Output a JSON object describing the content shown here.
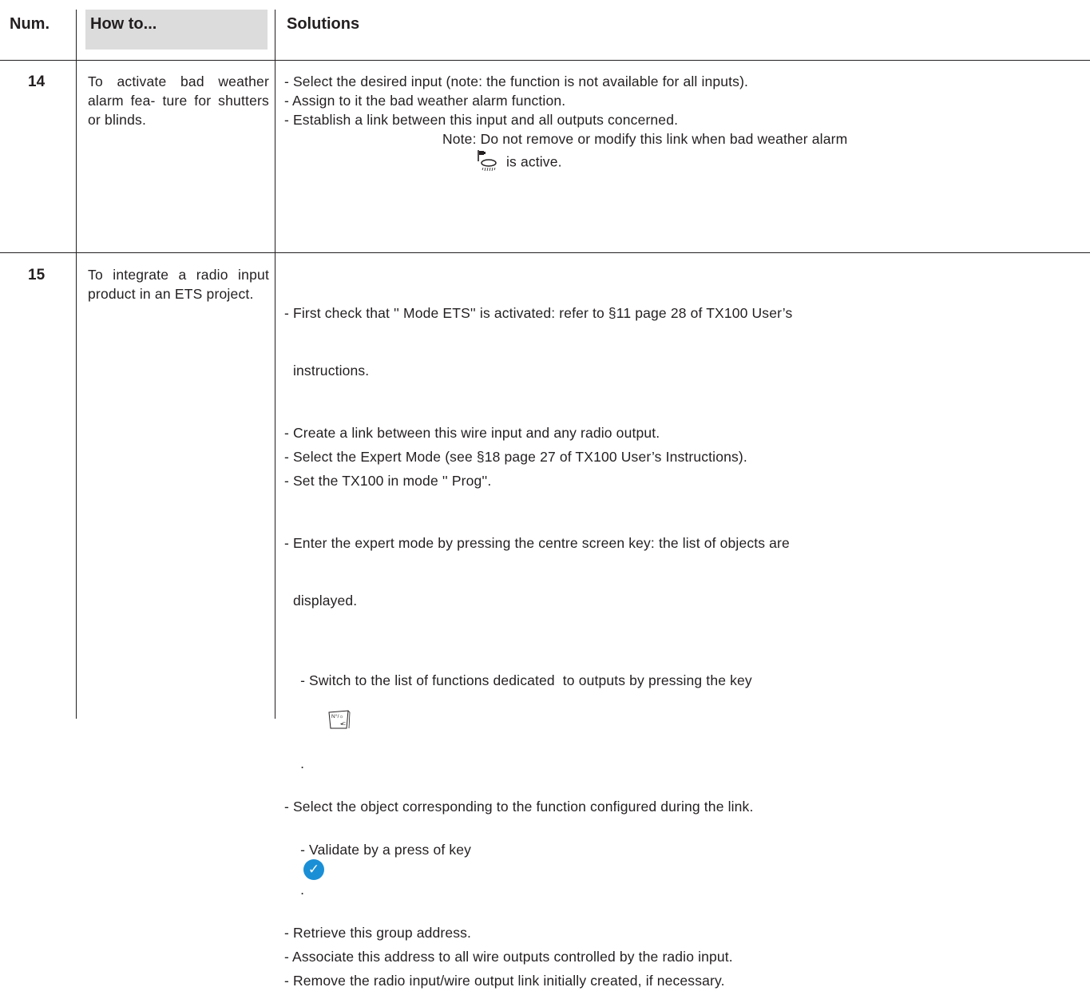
{
  "header": {
    "num": "Num.",
    "howto": "How to...",
    "solutions": "Solutions"
  },
  "rows": [
    {
      "num": "14",
      "howto": "To activate bad weather alarm fea- ture for shutters or blinds.",
      "items": [
        "- Select the desired input (note: the function is not available for all inputs).",
        "- Assign to it the bad weather alarm function.",
        "- Establish a link between this input and all outputs concerned."
      ],
      "note_line1": "Note: Do not remove or modify this link when bad weather alarm",
      "note_line2": "is active.",
      "note_icon": "bad-weather-alarm-icon"
    },
    {
      "num": "15",
      "howto": "To integrate a radio input product in an ETS project.",
      "items": [
        {
          "a": "- First check that '' Mode ETS'' is activated: refer to §11 page 28 of TX100 User’s",
          "b": "instructions."
        },
        "- Create a link between this wire input and any radio output.",
        "- Select the Expert Mode (see §18 page 27 of TX100 User’s Instructions).",
        "- Set the TX100 in mode '' Prog''.",
        {
          "a": "- Enter the expert mode by pressing the centre screen key: the list of objects are",
          "b": "displayed."
        },
        {
          "text": "- Switch to the list of functions dedicated  to outputs by pressing the key",
          "icon": "number-key-icon",
          "after": "."
        },
        "- Select the object corresponding to the function configured during the link.",
        {
          "text": "- Validate by a press of key",
          "icon": "check-icon",
          "after": "."
        },
        "- Retrieve this group address.",
        "- Associate this address to all wire outputs controlled by the radio input.",
        "- Remove the radio input/wire output link initially created, if necessary."
      ],
      "icon_glyphs": {
        "check": "✓",
        "key": "N°/☼"
      }
    }
  ]
}
